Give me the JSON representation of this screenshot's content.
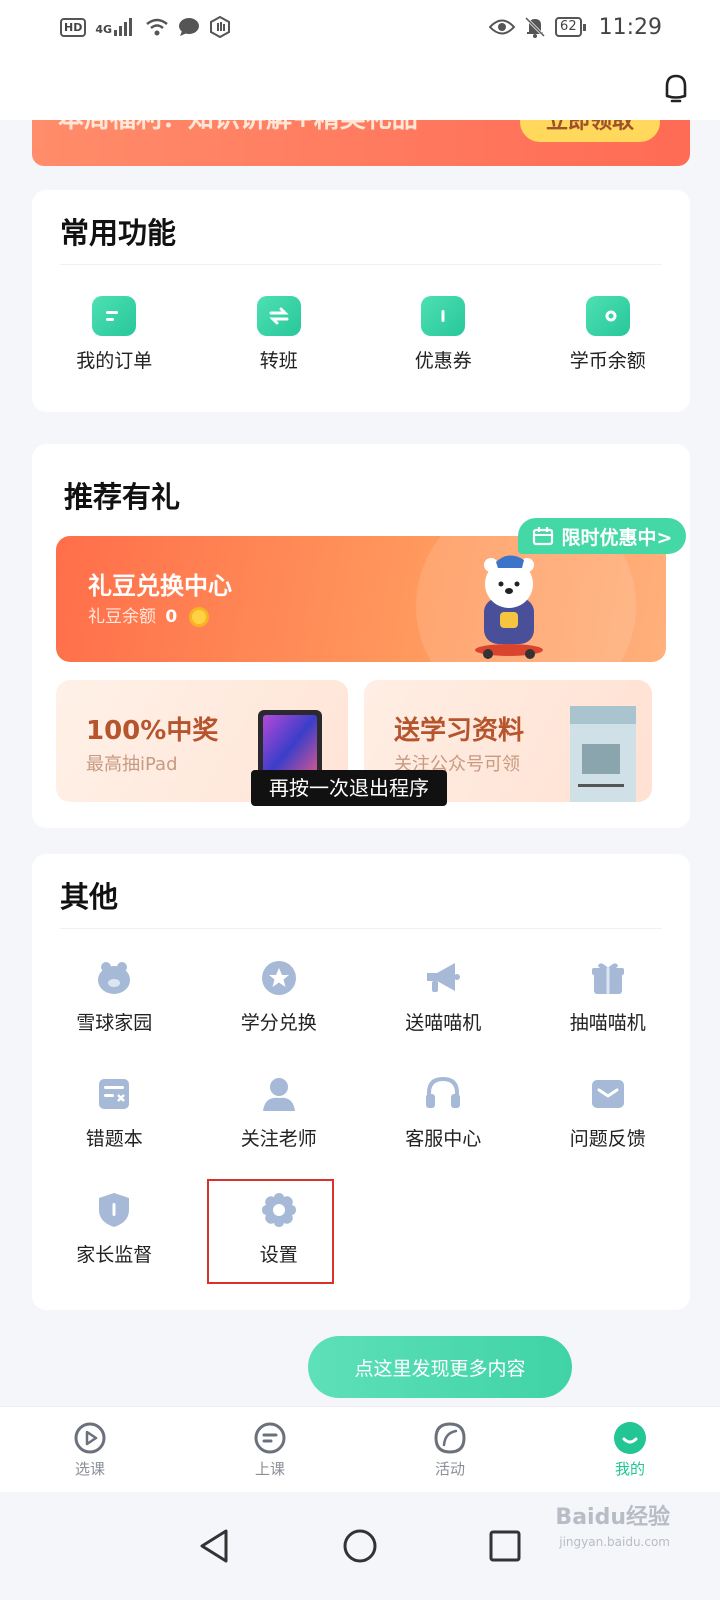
{
  "status_bar": {
    "hd": "HD",
    "network": "4G",
    "battery": "62",
    "time": "11:29"
  },
  "banner": {
    "text": "本周福利：知识讲解+精美礼品",
    "button": "立即领取"
  },
  "common": {
    "title": "常用功能",
    "items": [
      {
        "label": "我的订单",
        "icon": "order-icon"
      },
      {
        "label": "转班",
        "icon": "transfer-class-icon"
      },
      {
        "label": "优惠券",
        "icon": "coupon-icon"
      },
      {
        "label": "学币余额",
        "icon": "wallet-icon"
      }
    ]
  },
  "recommend": {
    "title": "推荐有礼",
    "main_title": "礼豆兑换中心",
    "balance_label": "礼豆余额",
    "balance_value": "0",
    "promo_tag": "限时优惠中>",
    "card1": {
      "title": "100%中奖",
      "sub": "最高抽iPad"
    },
    "card2": {
      "title": "送学习资料",
      "sub": "关注公众号可领"
    }
  },
  "toast": "再按一次退出程序",
  "other": {
    "title": "其他",
    "items": [
      {
        "label": "雪球家园",
        "icon": "pig-icon"
      },
      {
        "label": "学分兑换",
        "icon": "star-badge-icon"
      },
      {
        "label": "送喵喵机",
        "icon": "megaphone-icon"
      },
      {
        "label": "抽喵喵机",
        "icon": "gift-box-icon"
      },
      {
        "label": "错题本",
        "icon": "notebook-icon"
      },
      {
        "label": "关注老师",
        "icon": "person-icon"
      },
      {
        "label": "客服中心",
        "icon": "headset-icon"
      },
      {
        "label": "问题反馈",
        "icon": "mail-icon"
      },
      {
        "label": "家长监督",
        "icon": "shield-icon"
      },
      {
        "label": "设置",
        "icon": "gear-icon"
      }
    ]
  },
  "discover_button": "点这里发现更多内容",
  "tabs": [
    {
      "label": "选课",
      "icon": "play-circle-icon"
    },
    {
      "label": "上课",
      "icon": "class-icon"
    },
    {
      "label": "活动",
      "icon": "leaf-icon"
    },
    {
      "label": "我的",
      "icon": "smile-icon",
      "active": true
    }
  ],
  "watermark": {
    "text": "Baidu经验",
    "sub": "jingyan.baidu.com"
  },
  "colors": {
    "accent": "#22c593",
    "icon_blue": "#a6b9d6",
    "banner": "#ff7a5a"
  }
}
